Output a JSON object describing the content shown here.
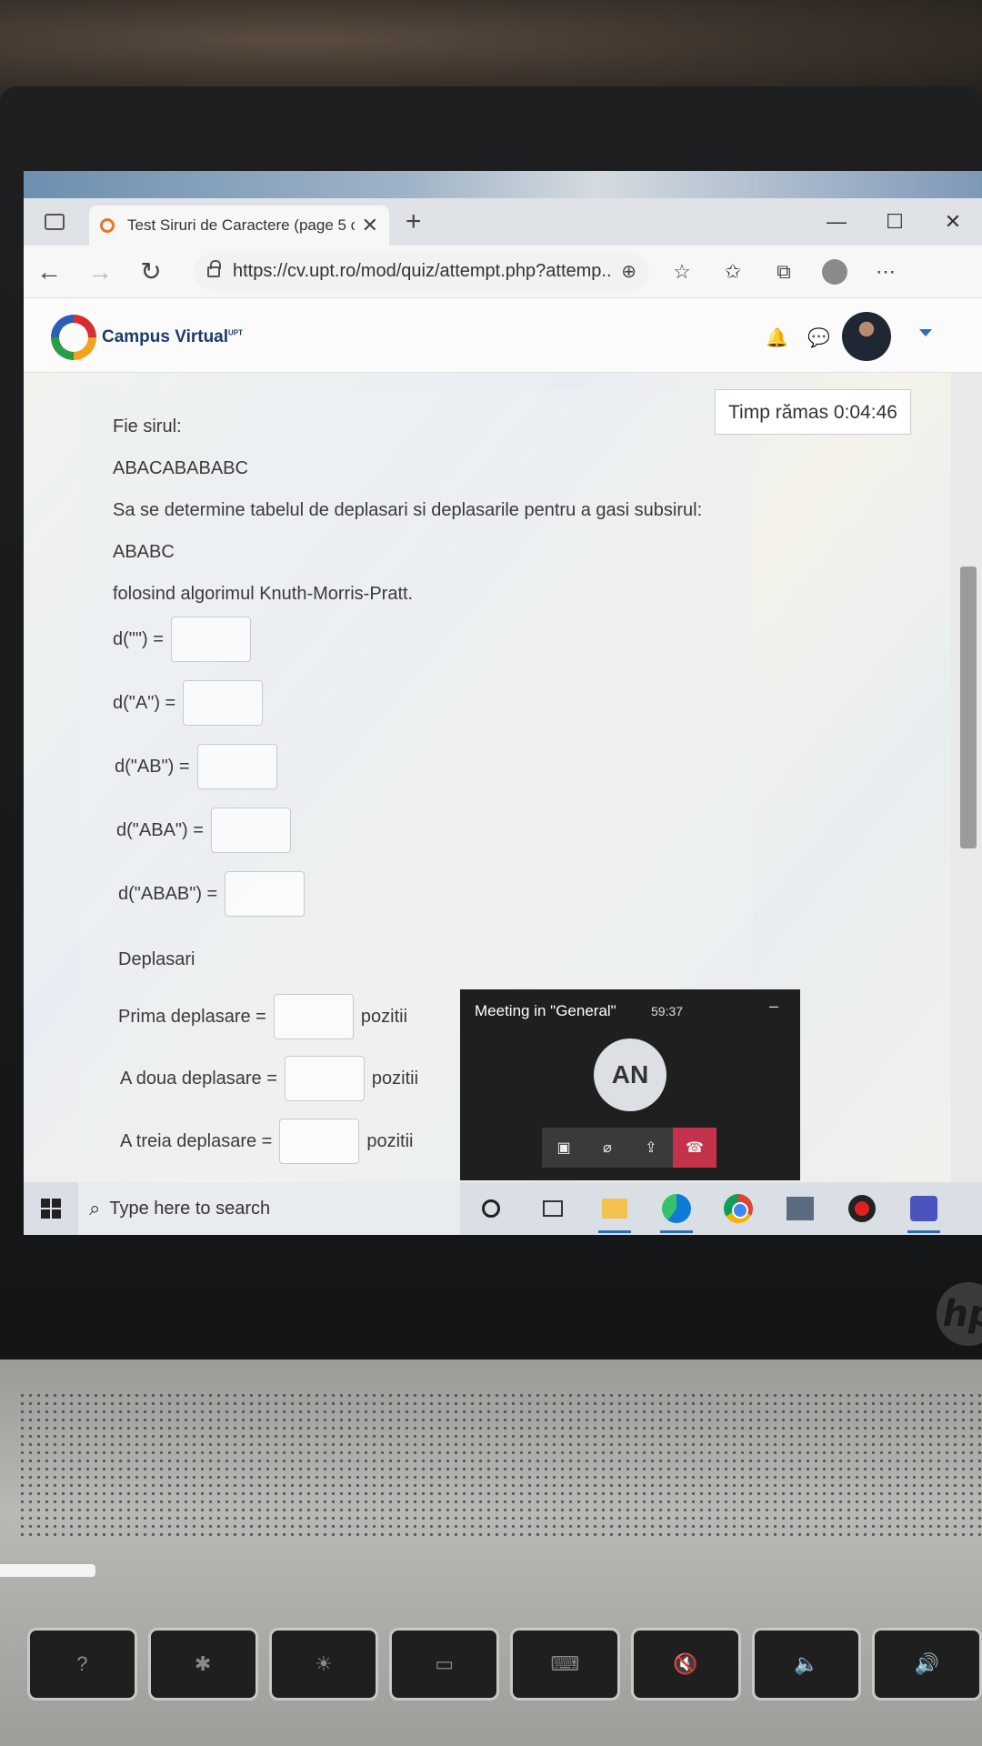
{
  "browser": {
    "tab_title": "Test Siruri de Caractere (page 5 c",
    "url": "https://cv.upt.ro/mod/quiz/attempt.php?attemp..."
  },
  "site": {
    "logo_text": "Campus Virtual",
    "logo_sup": "UPT"
  },
  "quiz": {
    "timer": "Timp rămas 0:04:46",
    "lines": [
      "Fie sirul:",
      "ABACABABABC",
      "Sa se determine tabelul de deplasari si deplasarile pentru a gasi subsirul:",
      "ABABC",
      "folosind algorimul Knuth-Morris-Pratt."
    ],
    "d_fields": [
      {
        "label": "d(\"\") =",
        "value": ""
      },
      {
        "label": "d(\"A\") =",
        "value": ""
      },
      {
        "label": "d(\"AB\") =",
        "value": ""
      },
      {
        "label": "d(\"ABA\") =",
        "value": ""
      },
      {
        "label": "d(\"ABAB\") =",
        "value": ""
      }
    ],
    "shifts_heading": "Deplasari",
    "shift_fields": [
      {
        "label": "Prima deplasare =",
        "value": "",
        "suffix": "pozitii"
      },
      {
        "label": "A doua deplasare =",
        "value": "",
        "suffix": "pozitii"
      },
      {
        "label": "A treia deplasare =",
        "value": "",
        "suffix": "pozitii"
      }
    ]
  },
  "meeting": {
    "title": "Meeting in \"General\"",
    "time": "59:37",
    "initials": "AN"
  },
  "taskbar": {
    "search_placeholder": "Type here to search"
  },
  "device": {
    "brand": "hp"
  }
}
